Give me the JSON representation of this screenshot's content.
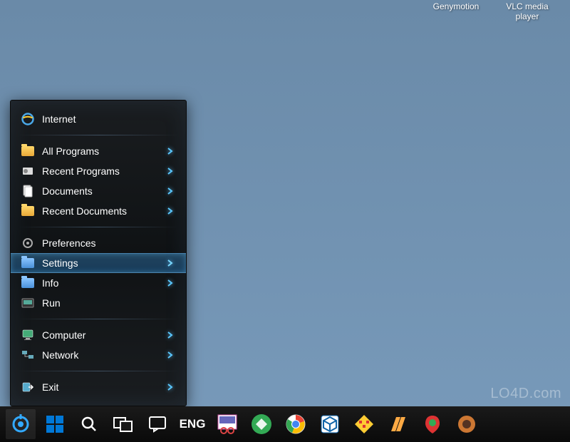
{
  "desktop": {
    "icons": [
      {
        "label": "Genymotion"
      },
      {
        "label": "VLC media player"
      }
    ]
  },
  "startMenu": {
    "internet": {
      "label": "Internet"
    },
    "programs": {
      "allPrograms": {
        "label": "All Programs",
        "hasSubmenu": true
      },
      "recentPrograms": {
        "label": "Recent Programs",
        "hasSubmenu": true
      },
      "documents": {
        "label": "Documents",
        "hasSubmenu": true
      },
      "recentDocuments": {
        "label": "Recent Documents",
        "hasSubmenu": true
      }
    },
    "system": {
      "preferences": {
        "label": "Preferences"
      },
      "settings": {
        "label": "Settings",
        "hasSubmenu": true,
        "highlighted": true
      },
      "info": {
        "label": "Info",
        "hasSubmenu": true
      },
      "run": {
        "label": "Run"
      }
    },
    "places": {
      "computer": {
        "label": "Computer",
        "hasSubmenu": true
      },
      "network": {
        "label": "Network",
        "hasSubmenu": true
      }
    },
    "exit": {
      "label": "Exit",
      "hasSubmenu": true
    }
  },
  "taskbar": {
    "language": "ENG"
  },
  "watermark": "LO4D.com"
}
